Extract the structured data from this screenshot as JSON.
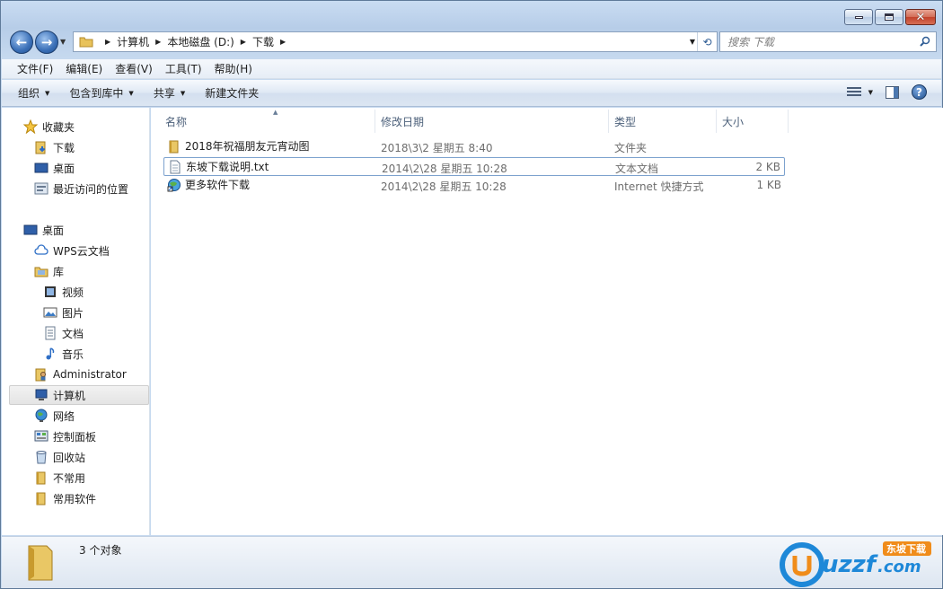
{
  "window": {
    "caption_buttons": [
      "minimize",
      "maximize",
      "close"
    ]
  },
  "nav": {
    "breadcrumbs": [
      "计算机",
      "本地磁盘 (D:)",
      "下载"
    ],
    "search_placeholder": "搜索 下载"
  },
  "menubar": {
    "items": [
      "文件(F)",
      "编辑(E)",
      "查看(V)",
      "工具(T)",
      "帮助(H)"
    ]
  },
  "toolbar": {
    "organize": "组织",
    "include_library": "包含到库中",
    "share": "共享",
    "new_folder": "新建文件夹"
  },
  "sidebar": {
    "items": [
      {
        "label": "收藏夹",
        "icon": "star-icon"
      },
      {
        "label": "下载",
        "icon": "download-folder-icon"
      },
      {
        "label": "桌面",
        "icon": "desktop-icon"
      },
      {
        "label": "最近访问的位置",
        "icon": "recent-places-icon"
      },
      {
        "label": "桌面",
        "icon": "desktop-icon"
      },
      {
        "label": "WPS云文档",
        "icon": "cloud-icon"
      },
      {
        "label": "库",
        "icon": "library-icon"
      },
      {
        "label": "视频",
        "icon": "video-icon"
      },
      {
        "label": "图片",
        "icon": "picture-icon"
      },
      {
        "label": "文档",
        "icon": "document-icon"
      },
      {
        "label": "音乐",
        "icon": "music-icon"
      },
      {
        "label": "Administrator",
        "icon": "user-folder-icon"
      },
      {
        "label": "计算机",
        "icon": "computer-icon"
      },
      {
        "label": "网络",
        "icon": "network-icon"
      },
      {
        "label": "控制面板",
        "icon": "control-panel-icon"
      },
      {
        "label": "回收站",
        "icon": "recycle-bin-icon"
      },
      {
        "label": "不常用",
        "icon": "folder-icon"
      },
      {
        "label": "常用软件",
        "icon": "folder-icon"
      }
    ]
  },
  "filelist": {
    "columns": [
      "名称",
      "修改日期",
      "类型",
      "大小"
    ],
    "rows": [
      {
        "name": "2018年祝福朋友元宵动图",
        "date": "2018\\3\\2 星期五 8:40",
        "type": "文件夹",
        "size": "",
        "icon": "folder-icon"
      },
      {
        "name": "东坡下载说明.txt",
        "date": "2014\\2\\28 星期五 10:28",
        "type": "文本文档",
        "size": "2 KB",
        "icon": "text-file-icon"
      },
      {
        "name": "更多软件下载",
        "date": "2014\\2\\28 星期五 10:28",
        "type": "Internet 快捷方式",
        "size": "1 KB",
        "icon": "internet-shortcut-icon"
      }
    ]
  },
  "status": {
    "count_text": "3 个对象"
  },
  "watermark": {
    "brand": "uzzf.com",
    "tag": "东坡下载"
  }
}
